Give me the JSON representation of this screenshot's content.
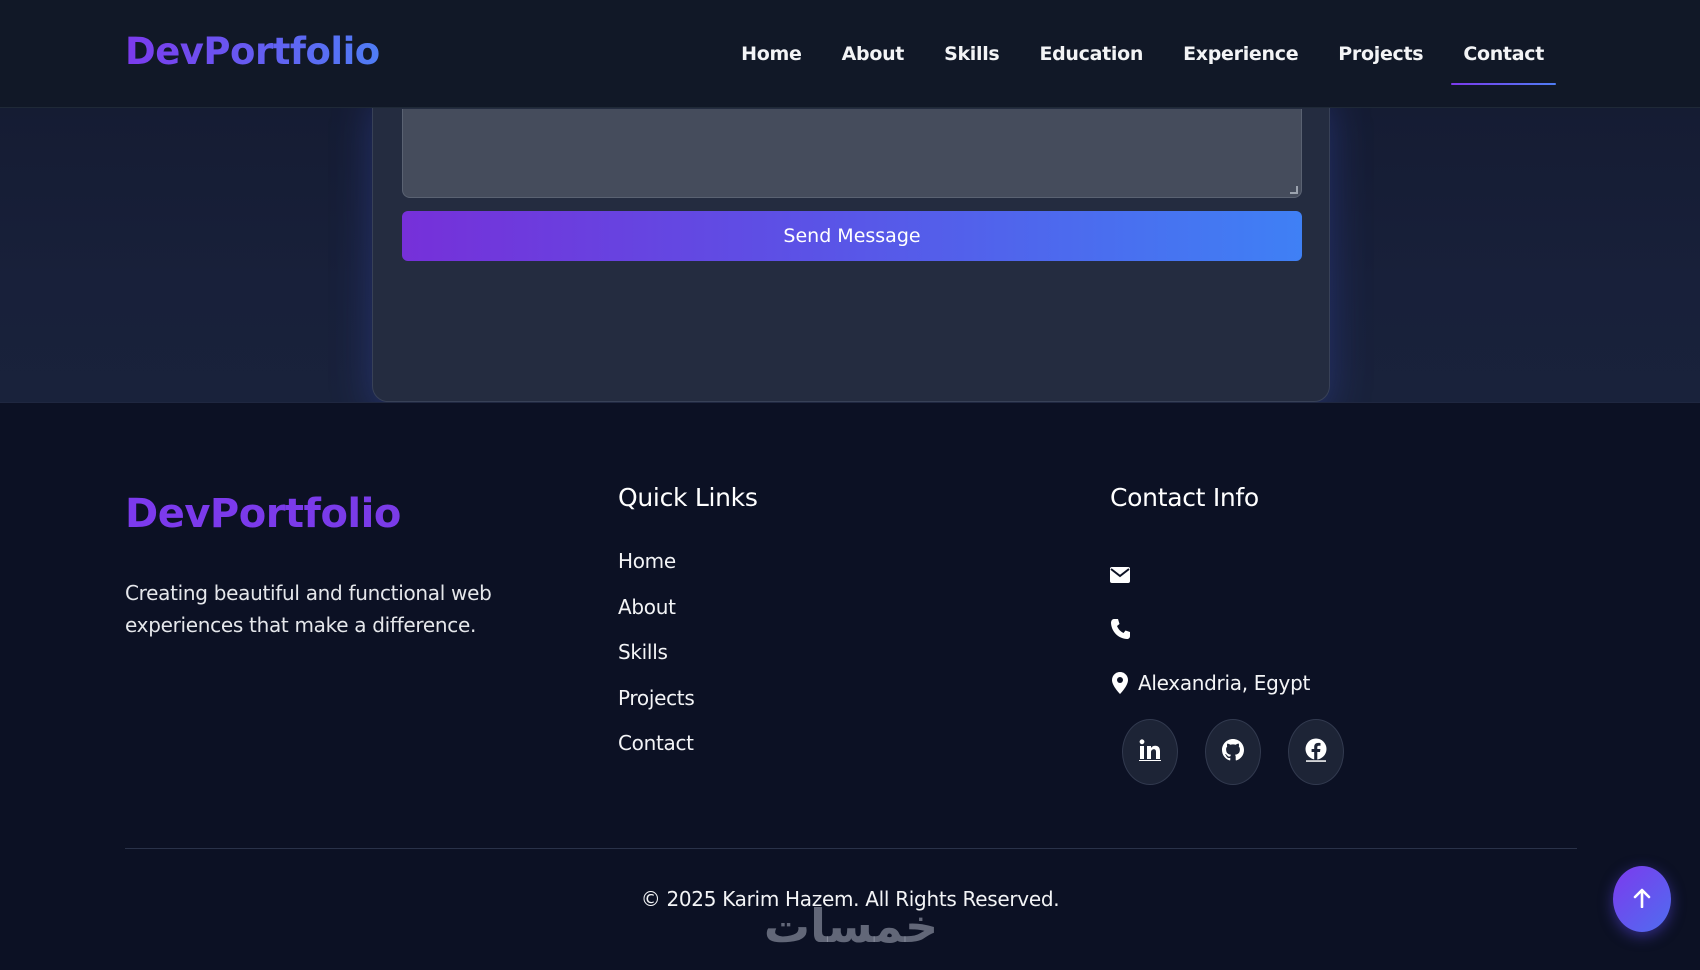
{
  "header": {
    "logo": "DevPortfolio",
    "nav": [
      {
        "label": "Home"
      },
      {
        "label": "About"
      },
      {
        "label": "Skills"
      },
      {
        "label": "Education"
      },
      {
        "label": "Experience"
      },
      {
        "label": "Projects"
      },
      {
        "label": "Contact"
      }
    ],
    "active": "Contact"
  },
  "contact_form": {
    "send_label": "Send Message"
  },
  "footer": {
    "logo": "DevPortfolio",
    "description": "Creating beautiful and functional web experiences that make a difference.",
    "quick_links_title": "Quick Links",
    "quick_links": [
      "Home",
      "About",
      "Skills",
      "Projects",
      "Contact"
    ],
    "contact_title": "Contact Info",
    "contact": {
      "email_icon": "envelope-icon",
      "phone_icon": "phone-icon",
      "location_icon": "map-pin-icon",
      "location": "Alexandria, Egypt"
    },
    "socials": [
      "linkedin-icon",
      "github-icon",
      "facebook-icon"
    ],
    "copyright": "© 2025 Karim Hazem. All Rights Reserved.",
    "watermark": "خمسات"
  },
  "colors": {
    "accent_purple": "#7c3aed",
    "accent_blue": "#3f80f5",
    "background": "#0c1124"
  }
}
